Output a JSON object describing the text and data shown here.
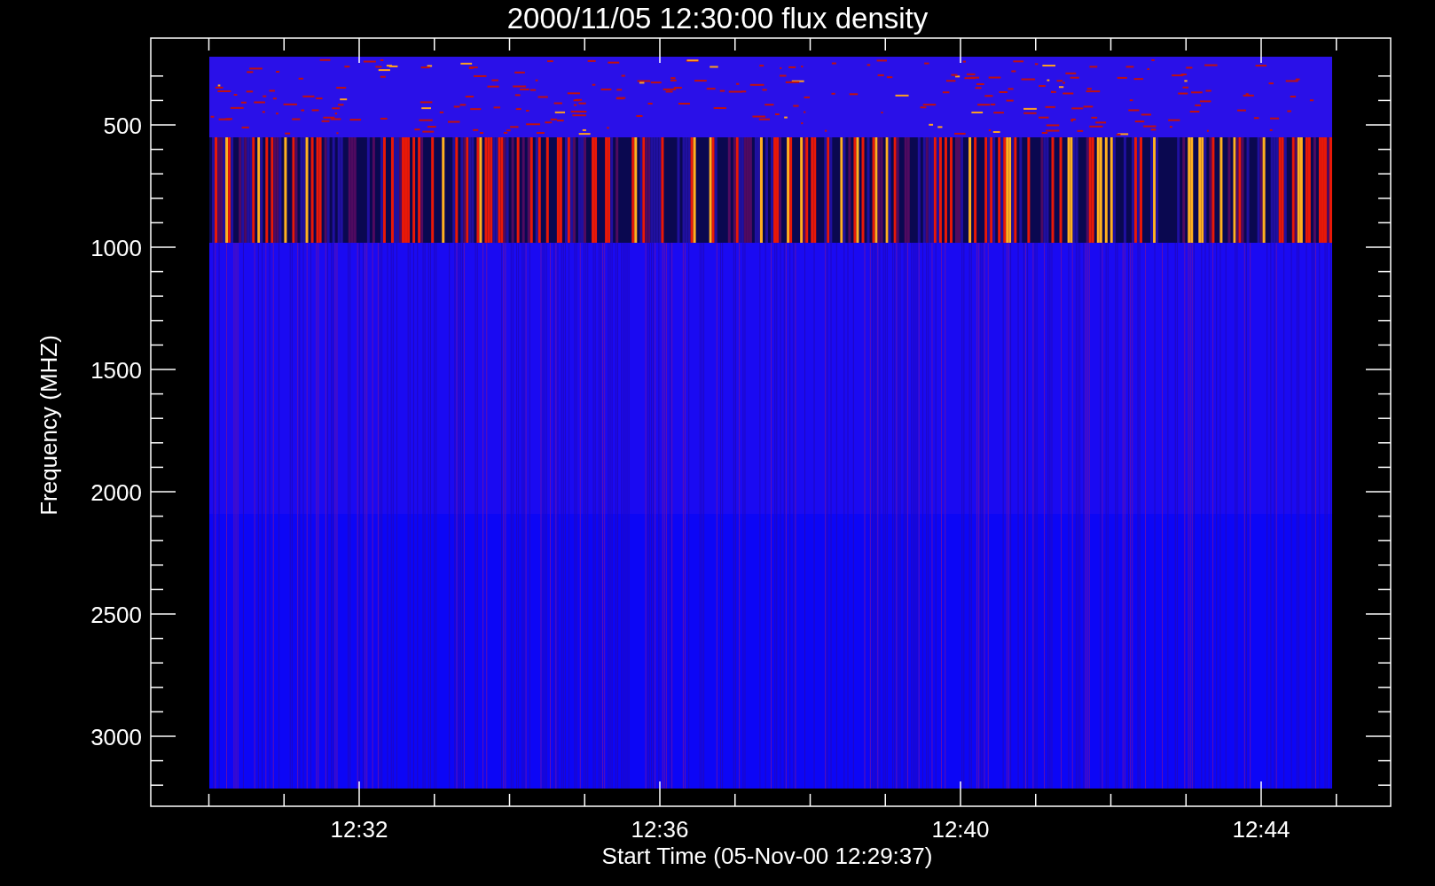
{
  "plot": {
    "title": "2000/11/05 12:30:00 flux density",
    "x_axis": {
      "label": "Start Time (05-Nov-00 12:29:37)",
      "ticks": [
        "12:32",
        "12:36",
        "12:40",
        "12:44"
      ]
    },
    "y_axis": {
      "label": "Frequency (MHZ)",
      "ticks": [
        "500",
        "1000",
        "1500",
        "2000",
        "2500",
        "3000"
      ]
    }
  }
}
